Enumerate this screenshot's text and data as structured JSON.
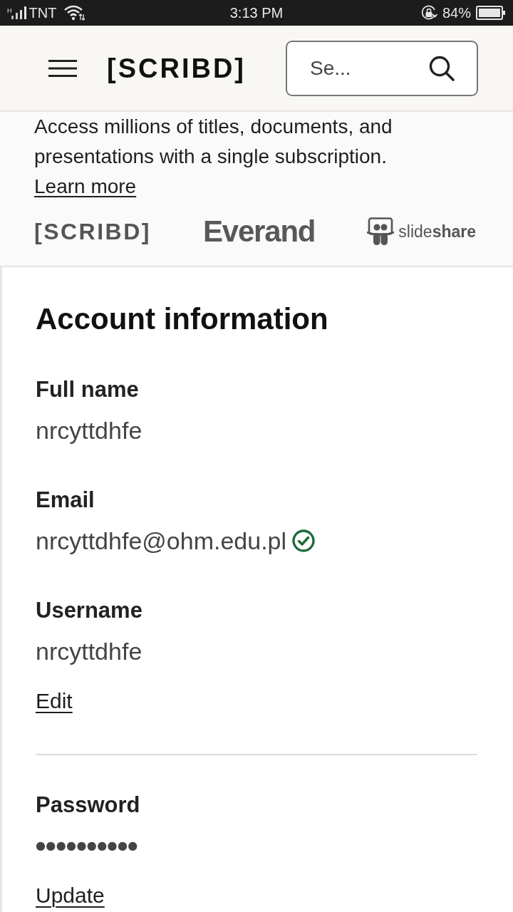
{
  "status_bar": {
    "network_type": "H",
    "carrier": "TNT",
    "time": "3:13 PM",
    "battery": "84%"
  },
  "header": {
    "logo": "[SCRIBD]",
    "search": {
      "placeholder": "Se..."
    }
  },
  "promo": {
    "text": "Access millions of titles, documents, and presentations with a single subscription.",
    "link": "Learn more",
    "brands": [
      {
        "kind": "scribd",
        "label": "[SCRIBD]"
      },
      {
        "kind": "everand",
        "label": "Everand"
      },
      {
        "kind": "slideshare",
        "label": "slide**share**"
      }
    ]
  },
  "account": {
    "title": "Account information",
    "sections": [
      {
        "fields": [
          {
            "kind": "text",
            "label": "Full name",
            "value": "nrcyttdhfe",
            "verified": false
          },
          {
            "kind": "text",
            "label": "Email",
            "value": "nrcyttdhfe@ohm.edu.pl",
            "verified": true
          },
          {
            "kind": "text",
            "label": "Username",
            "value": "nrcyttdhfe",
            "verified": false
          }
        ],
        "action": "Edit"
      },
      {
        "fields": [
          {
            "kind": "password",
            "label": "Password",
            "value": "●●●●●●●●●●",
            "verified": false
          }
        ],
        "action": "Update"
      }
    ]
  }
}
